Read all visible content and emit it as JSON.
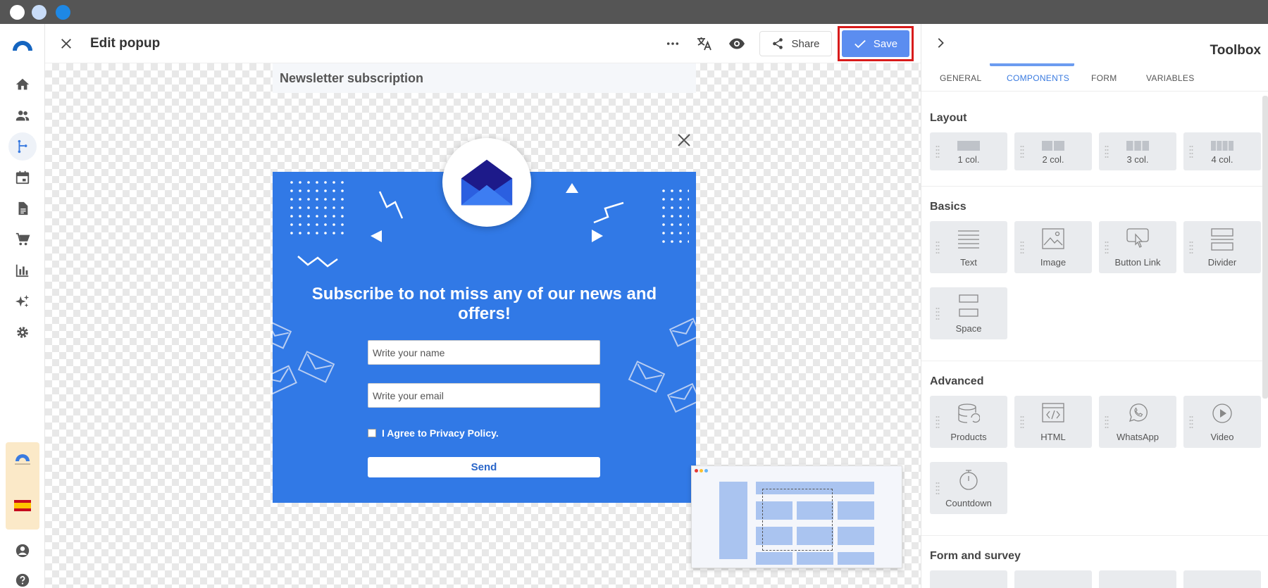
{
  "window": {
    "dot_colors": [
      "#ffffff",
      "#c8dcf8",
      "#1e88e5"
    ]
  },
  "nav": {
    "items": [
      "home-icon",
      "contacts-icon",
      "automation-icon",
      "calendar-icon",
      "document-icon",
      "cart-icon",
      "reports-icon",
      "sparkle-icon",
      "settings-icon"
    ],
    "active": "automation-icon",
    "bottom": [
      "user-icon",
      "help-icon"
    ]
  },
  "header": {
    "title": "Edit popup",
    "share_label": "Share",
    "save_label": "Save"
  },
  "canvas": {
    "page_title": "Newsletter subscription",
    "popup": {
      "heading": "Subscribe to not miss any of our news and offers!",
      "name_placeholder": "Write your name",
      "email_placeholder": "Write your email",
      "agree_label": "I Agree to Privacy Policy.",
      "send_label": "Send",
      "bg_color": "#3179e6"
    }
  },
  "toolbox": {
    "title": "Toolbox",
    "tabs": [
      {
        "label": "GENERAL"
      },
      {
        "label": "COMPONENTS"
      },
      {
        "label": "FORM"
      },
      {
        "label": "VARIABLES"
      }
    ],
    "active_tab": "COMPONENTS",
    "sections": {
      "layout": {
        "title": "Layout",
        "items": [
          "1 col.",
          "2 col.",
          "3 col.",
          "4 col."
        ]
      },
      "basics": {
        "title": "Basics",
        "items": [
          "Text",
          "Image",
          "Button Link",
          "Divider",
          "Space"
        ]
      },
      "advanced": {
        "title": "Advanced",
        "items": [
          "Products",
          "HTML",
          "WhatsApp",
          "Video",
          "Countdown"
        ]
      },
      "form_survey": {
        "title": "Form and survey"
      }
    }
  }
}
